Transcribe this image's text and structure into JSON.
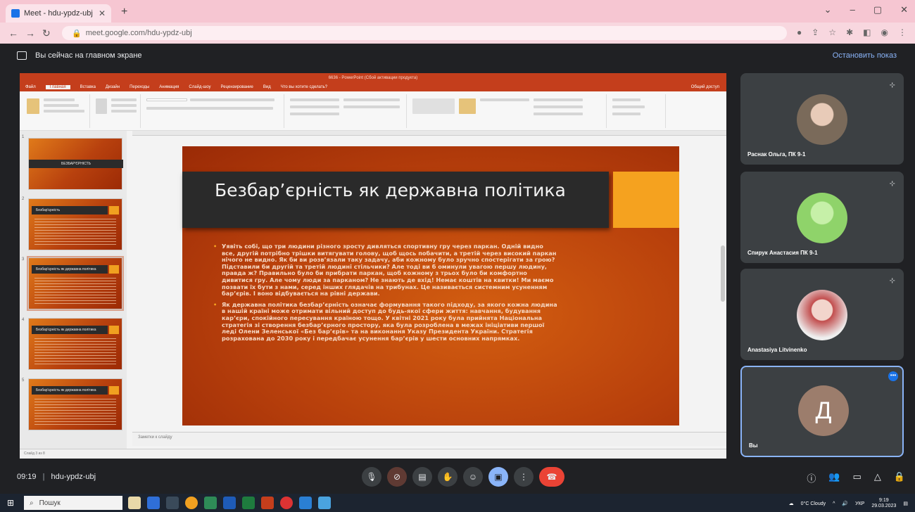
{
  "browser": {
    "tab_title": "Meet - hdu-ypdz-ubj",
    "url": "meet.google.com/hdu-ypdz-ubj"
  },
  "banner": {
    "text": "Вы сейчас на главном экране",
    "stop_label": "Остановить показ"
  },
  "ppt": {
    "window_title": "6636 - PowerPoint (Сбой активации продукта)",
    "tabs": [
      "Файл",
      "Главная",
      "Вставка",
      "Дизайн",
      "Переходы",
      "Анимация",
      "Слайд-шоу",
      "Рецензирование",
      "Вид",
      "Что вы хотите сделать?"
    ],
    "share_label": "Общий доступ",
    "notes_label": "Заметки к слайду",
    "status_label": "Слайд 3 из 8"
  },
  "thumbnails": [
    {
      "num": "1",
      "title": "БЕЗБАР'ЄРНІСТЬ",
      "kind": "cover"
    },
    {
      "num": "2",
      "title": "Безбар'єрність",
      "kind": "content"
    },
    {
      "num": "3",
      "title": "Безбар'єрність як державна політика",
      "kind": "content",
      "selected": true
    },
    {
      "num": "4",
      "title": "Безбар'єрність як державна політика",
      "kind": "content"
    },
    {
      "num": "5",
      "title": "Безбар'єрність як державна політика",
      "kind": "content"
    }
  ],
  "slide": {
    "title": "Безбар’єрність як державна політика",
    "bullets": [
      "Уявіть собі, що три людини різного зросту дивляться спортивну гру через паркан. Одній видно все, другій потрібно трішки витягувати голову, щоб щось побачити, а третій через високий паркан нічого не видно. Як би ви розв’язали таку задачу, аби кожному було зручно спостерігати за грою? Підставили би другій та третій людині стільчики? Але тоді ви б оминули увагою першу людину, правда ж? Правильно було би прибрати паркан, щоб кожному з трьох було би комфортно дивитися гру. Але чому люди за парканом? Не знають де вхід! Немає коштів на квитки! Ми маємо позвати їх бути з нами, серед інших глядачів на трибунах. Це називається системним усуненням бар’єрів. І воно відбувається на рівні держави.",
      "Як державна політика безбар’єрність означає формування такого підходу, за якого кожна людина в нашій країні може отримати вільний доступ до будь-якої сфери життя: навчання, будування кар’єри, спокійного пересування країною тощо. У квітні 2021 року була прийнята Національна стратегія зі створення безбар’єрного простору, яка була розроблена в межах ініціативи першої леді Олени Зеленської «Без бар’єрів» та на виконання Указу Президента України. Стратегія розрахована до 2030 року і передбачає усунення бар’єрів у шести основних напрямках."
    ]
  },
  "participants": [
    {
      "name": "Раснак Ольга, ПК 9-1",
      "avatar_color": "#7a6a5a"
    },
    {
      "name": "Спирук Анастасия ПК 9-1",
      "avatar_color": "#8fd36a"
    },
    {
      "name": "Anastasiya Litvinenko",
      "avatar_color": "#c24d4d"
    },
    {
      "name": "Вы",
      "avatar_letter": "Д",
      "avatar_color": "#9c7d6c"
    }
  ],
  "meeting": {
    "time": "09:19",
    "code": "hdu-ypdz-ubj"
  },
  "taskbar": {
    "search_placeholder": "Пошук",
    "weather": "0°C Cloudy",
    "lang": "УКР",
    "clock_time": "9:19",
    "clock_date": "29.03.2023"
  }
}
